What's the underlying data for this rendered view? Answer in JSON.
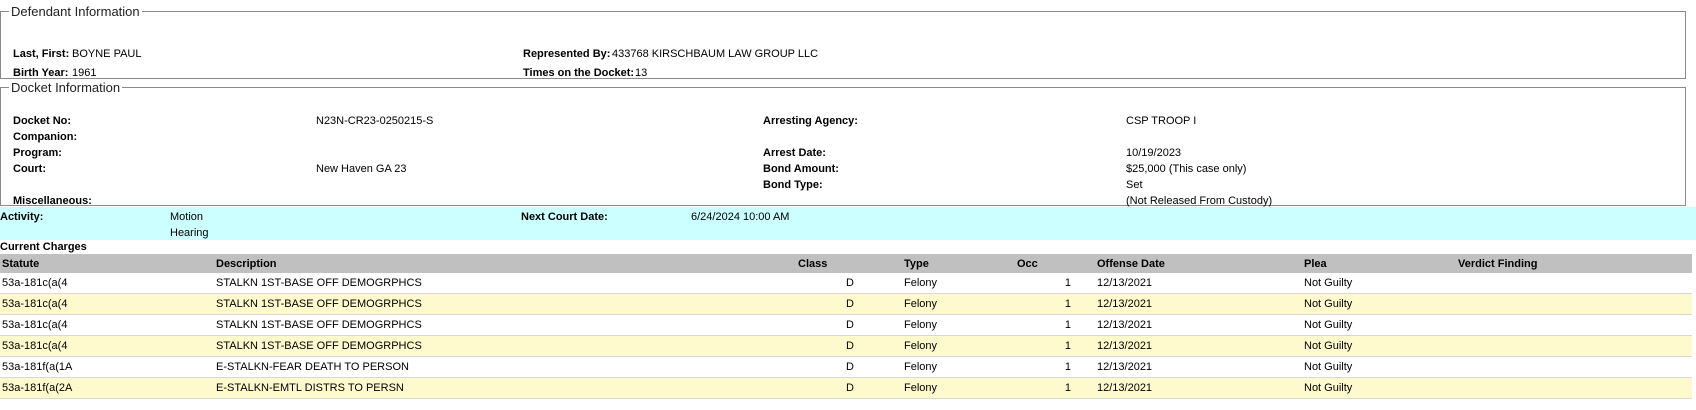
{
  "defendant": {
    "legend": "Defendant Information",
    "last_first_label": "Last, First:",
    "last_first": "BOYNE PAUL",
    "birth_year_label": "Birth Year:",
    "birth_year": "1961",
    "represented_by_label": "Represented By:",
    "represented_by": "433768 KIRSCHBAUM LAW GROUP LLC",
    "times_label": "Times on the Docket:",
    "times": "13"
  },
  "docket": {
    "legend": "Docket Information",
    "docket_no_label": "Docket No:",
    "docket_no": "N23N-CR23-0250215-S",
    "companion_label": "Companion:",
    "program_label": "Program:",
    "court_label": "Court:",
    "court": "New Haven GA 23",
    "misc_label": "Miscellaneous:",
    "arresting_agency_label": "Arresting Agency:",
    "arresting_agency": "CSP TROOP I",
    "arrest_date_label": "Arrest Date:",
    "arrest_date": "10/19/2023",
    "bond_amount_label": "Bond Amount:",
    "bond_amount": "$25,000 (This case only)",
    "bond_type_label": "Bond Type:",
    "bond_type": "Set",
    "custody": "(Not Released From Custody)"
  },
  "activity": {
    "label": "Activity:",
    "line1": "Motion",
    "line2": "Hearing",
    "next_label": "Next Court Date:",
    "next_date": "6/24/2024 10:00 AM"
  },
  "charges": {
    "title": "Current Charges",
    "headers": [
      "Statute",
      "Description",
      "Class",
      "Type",
      "Occ",
      "Offense Date",
      "Plea",
      "Verdict Finding"
    ],
    "rows": [
      {
        "statute": "53a-181c(a(4",
        "description": "STALKN 1ST-BASE OFF DEMOGRPHCS",
        "class": "D",
        "type": "Felony",
        "occ": "1",
        "offense_date": "12/13/2021",
        "plea": "Not Guilty",
        "verdict": ""
      },
      {
        "statute": "53a-181c(a(4",
        "description": "STALKN 1ST-BASE OFF DEMOGRPHCS",
        "class": "D",
        "type": "Felony",
        "occ": "1",
        "offense_date": "12/13/2021",
        "plea": "Not Guilty",
        "verdict": ""
      },
      {
        "statute": "53a-181c(a(4",
        "description": "STALKN 1ST-BASE OFF DEMOGRPHCS",
        "class": "D",
        "type": "Felony",
        "occ": "1",
        "offense_date": "12/13/2021",
        "plea": "Not Guilty",
        "verdict": ""
      },
      {
        "statute": "53a-181c(a(4",
        "description": "STALKN 1ST-BASE OFF DEMOGRPHCS",
        "class": "D",
        "type": "Felony",
        "occ": "1",
        "offense_date": "12/13/2021",
        "plea": "Not Guilty",
        "verdict": ""
      },
      {
        "statute": "53a-181f(a(1A",
        "description": "E-STALKN-FEAR DEATH TO PERSON",
        "class": "D",
        "type": "Felony",
        "occ": "1",
        "offense_date": "12/13/2021",
        "plea": "Not Guilty",
        "verdict": ""
      },
      {
        "statute": "53a-181f(a(2A",
        "description": "E-STALKN-EMTL DISTRS TO PERSN",
        "class": "D",
        "type": "Felony",
        "occ": "1",
        "offense_date": "12/13/2021",
        "plea": "Not Guilty",
        "verdict": ""
      }
    ]
  }
}
